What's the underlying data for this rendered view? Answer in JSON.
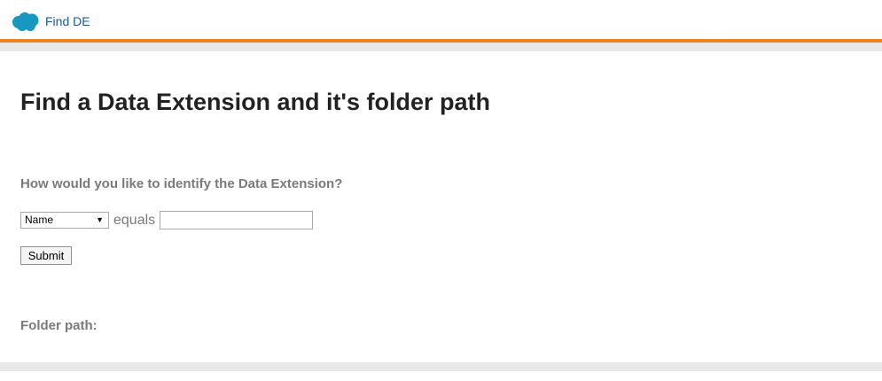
{
  "header": {
    "app_title": "Find DE",
    "logo_icon": "salesforce-cloud-icon",
    "brand_color": "#1798c1",
    "accent_color": "#e8871e"
  },
  "main": {
    "title": "Find a Data Extension and it's folder path",
    "question": "How would you like to identify the Data Extension?",
    "field_select": {
      "selected": "Name"
    },
    "operator": "equals",
    "value_input": {
      "value": "",
      "placeholder": ""
    },
    "submit_label": "Submit",
    "folder_path_label": "Folder path:",
    "folder_path_value": ""
  }
}
